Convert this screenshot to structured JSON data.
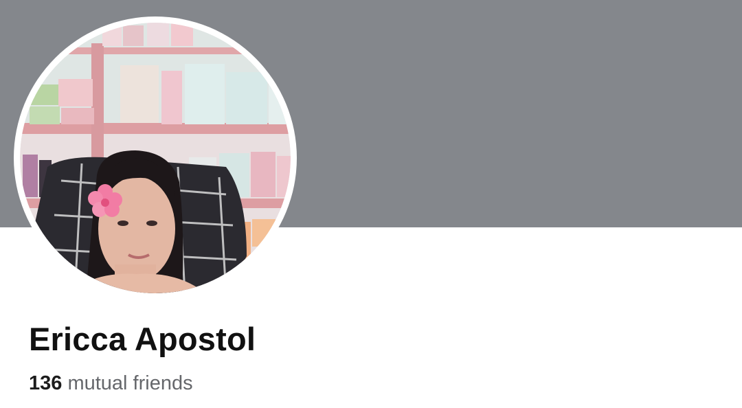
{
  "profile": {
    "name": "Ericca Apostol",
    "mutual_count": "136",
    "mutual_label": "mutual friends",
    "avatar_icon": "profile-photo"
  },
  "colors": {
    "cover": "#84878c",
    "name_text": "#111111",
    "secondary_text": "#65676b"
  }
}
